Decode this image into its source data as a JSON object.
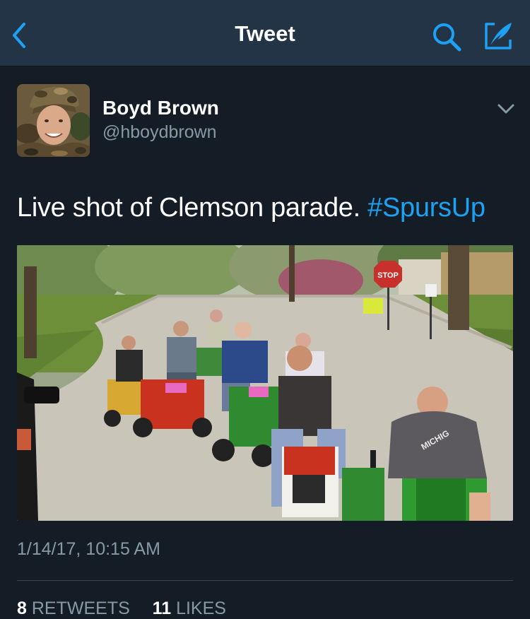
{
  "navbar": {
    "title": "Tweet",
    "back_icon": "chevron-left-icon",
    "search_icon": "search-icon",
    "compose_icon": "compose-quill-icon",
    "accent_color": "#1da1f2"
  },
  "tweet": {
    "author": {
      "name": "Boyd Brown",
      "handle": "@hboydbrown"
    },
    "text": "Live shot of Clemson parade. ",
    "hashtag": "#SpursUp",
    "image_sign_text": "STOP",
    "image_shirt_text": "MICHIG",
    "timestamp": "1/14/17, 10:15 AM",
    "stats": {
      "retweets_count": "8",
      "retweets_label": "RETWEETS",
      "likes_count": "11",
      "likes_label": "LIKES"
    }
  },
  "colors": {
    "background": "#141d26",
    "navbar": "#243447",
    "secondary_text": "#8899a6",
    "link": "#1da1f2"
  }
}
